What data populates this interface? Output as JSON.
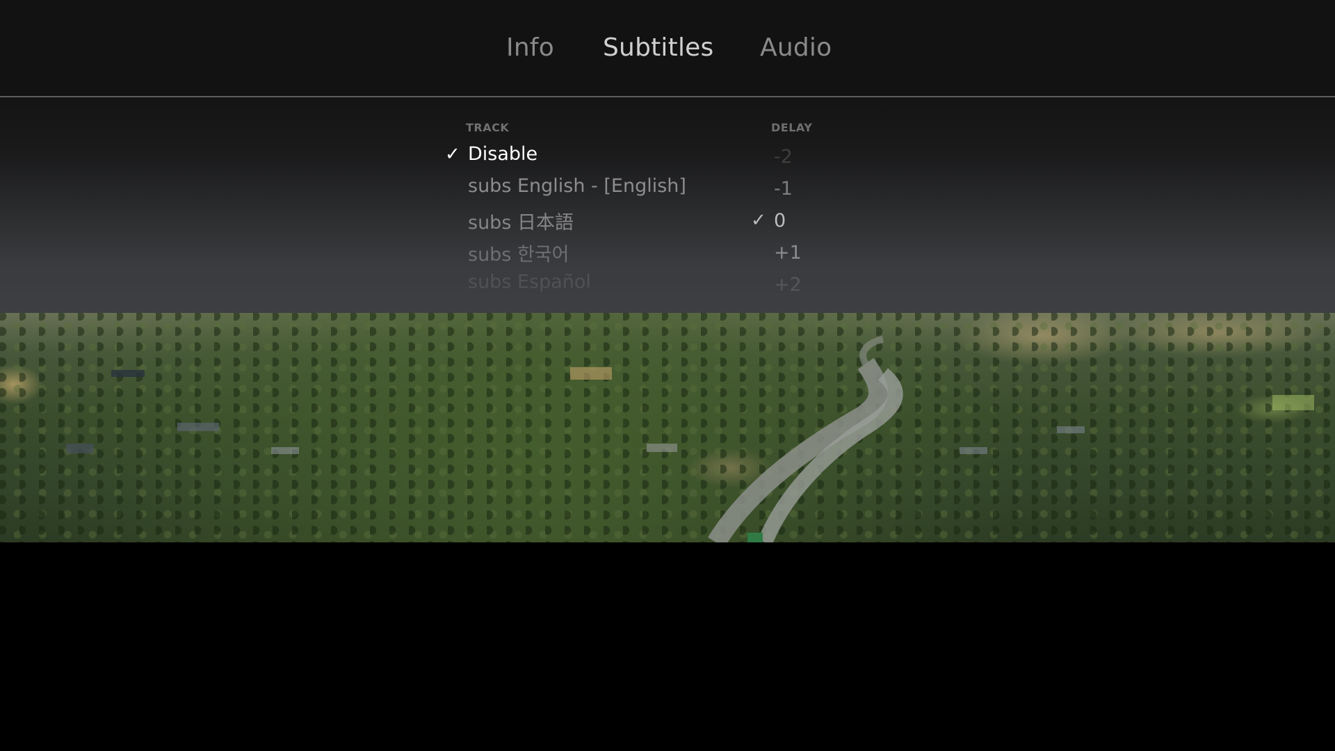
{
  "tabs": [
    {
      "label": "Info"
    },
    {
      "label": "Subtitles",
      "active": true
    },
    {
      "label": "Audio"
    }
  ],
  "columns": {
    "track": "TRACK",
    "delay": "DELAY"
  },
  "tracks": [
    {
      "label": "Disable",
      "selected": true
    },
    {
      "label": "subs English - [English]"
    },
    {
      "label": "subs 日本語"
    },
    {
      "label": "subs 한국어"
    },
    {
      "label": "subs Español"
    }
  ],
  "delays": [
    {
      "label": "-2"
    },
    {
      "label": "-1"
    },
    {
      "label": "0",
      "selected": true
    },
    {
      "label": "+1"
    },
    {
      "label": "+2"
    }
  ],
  "check_glyph": "✓"
}
